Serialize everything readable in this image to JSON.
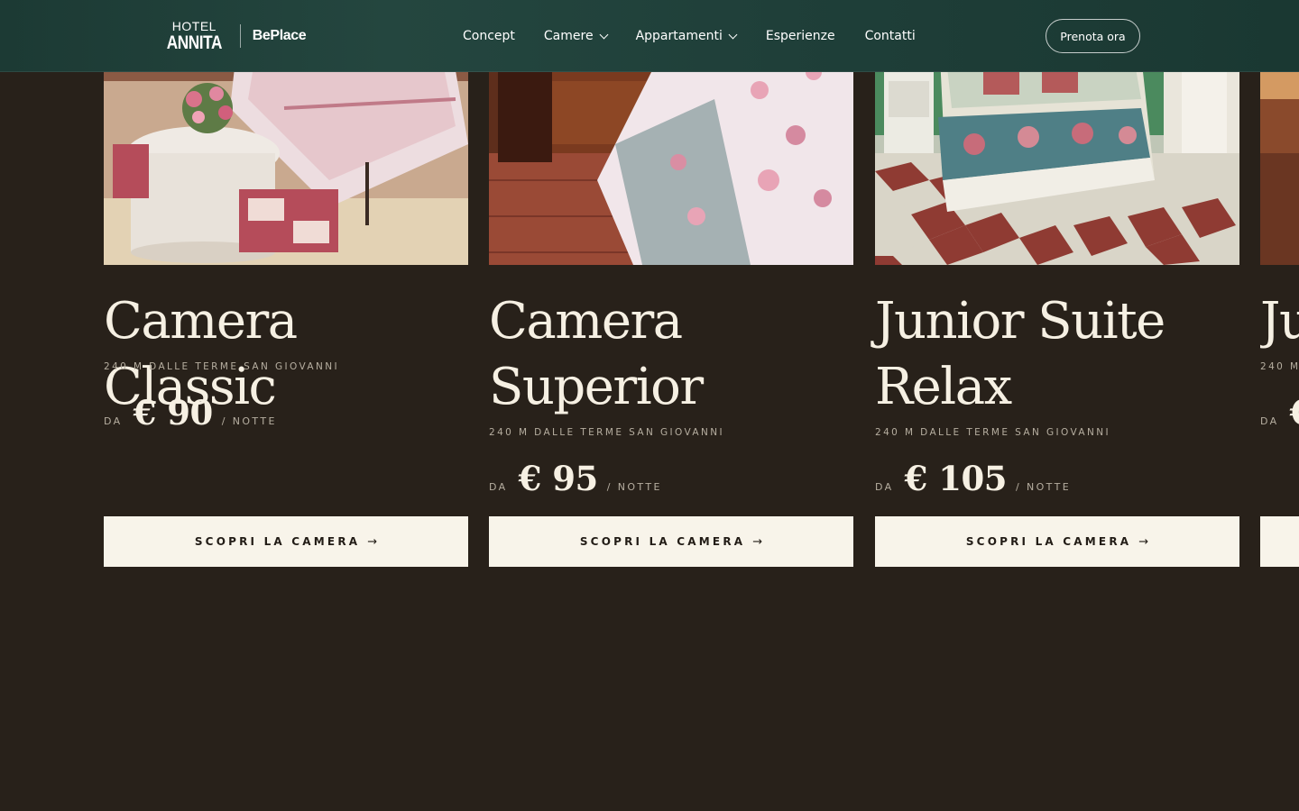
{
  "header": {
    "logo_hotel_line1": "HOTEL",
    "logo_hotel_line2": "ANNITA",
    "logo_beplace": "BePlace",
    "nav": {
      "concept": "Concept",
      "camere": "Camere",
      "appartamenti": "Appartamenti",
      "esperienze": "Esperienze",
      "contatti": "Contatti"
    },
    "book_label": "Prenota ora"
  },
  "rooms": [
    {
      "title": "Camera Classic",
      "distance": "240 M DALLE TERME SAN GIOVANNI",
      "price_prefix": "DA",
      "price": "€ 90",
      "price_suffix": "/ NOTTE",
      "cta": "SCOPRI LA CAMERA",
      "arrow": "→"
    },
    {
      "title": "Camera Superior",
      "distance": "240 M DALLE TERME SAN GIOVANNI",
      "price_prefix": "DA",
      "price": "€ 95",
      "price_suffix": "/ NOTTE",
      "cta": "SCOPRI LA CAMERA",
      "arrow": "→"
    },
    {
      "title": "Junior Suite Relax",
      "distance": "240 M DALLE TERME SAN GIOVANNI",
      "price_prefix": "DA",
      "price": "€ 105",
      "price_suffix": "/ NOTTE",
      "cta": "SCOPRI LA CAMERA",
      "arrow": "→"
    },
    {
      "title": "Ju",
      "distance": "240 M",
      "price_prefix": "DA",
      "price": "€",
      "price_suffix": "",
      "cta": "",
      "arrow": ""
    }
  ],
  "colors": {
    "page_bg": "#28211a",
    "header_bg": "#1f3f39",
    "button_bg": "#f8f4ea",
    "title_text": "#f6f0e3",
    "muted_text": "#b6aea0"
  }
}
